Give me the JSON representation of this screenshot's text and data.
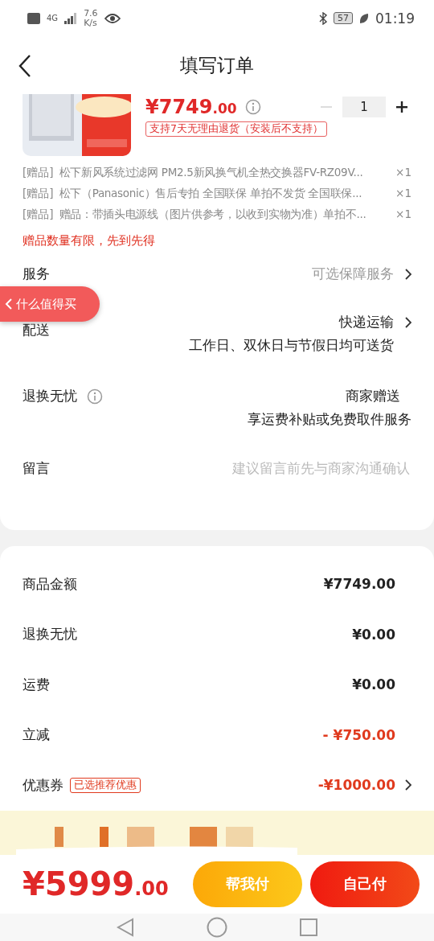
{
  "status_bar": {
    "network": "4G",
    "speed": "7.6",
    "speed_unit": "K/s",
    "battery": "57",
    "time": "01:19"
  },
  "header": {
    "title": "填写订单"
  },
  "product": {
    "kind": "picture",
    "price": {
      "currency": "¥",
      "integer": "7749",
      "decimals": ".00"
    },
    "quantity": "1",
    "minus_disabled": true,
    "return_tag": "支持7天无理由退货（安装后不支持）"
  },
  "gifts": [
    {
      "tag": "[赠品]",
      "name": "松下新风系统过滤网 PM2.5新风换气机全热交换器FV-RZ09V...",
      "count": "×1"
    },
    {
      "tag": "[赠品]",
      "name": "松下（Panasonic）售后专拍 全国联保 单拍不发货 全国联保...",
      "count": "×1"
    },
    {
      "tag": "[赠品]",
      "name": "赠品：带插头电源线（图片供参考，以收到实物为准）单拍不...",
      "count": "×1"
    }
  ],
  "gift_notice": "赠品数量有限，先到先得",
  "options": [
    {
      "label": "服务",
      "value": "可选保障服务",
      "muted": true,
      "chevron": true
    },
    {
      "label": "配送",
      "value": "快递运输",
      "detail": "工作日、双休日与节假日均可送货",
      "muted": false,
      "chevron": true
    },
    {
      "label": "退换无忧",
      "info": true,
      "value": "商家赠送",
      "detail": "享运费补贴或免费取件服务",
      "muted": false,
      "chevron": false
    },
    {
      "label": "留言",
      "placeholder": "建议留言前先与商家沟通确认"
    }
  ],
  "floating_pill": {
    "label": "什么值得买"
  },
  "summary": [
    {
      "label": "商品金额",
      "value": "¥7749.00",
      "highlight": false,
      "chevron": false
    },
    {
      "label": "退换无忧",
      "value": "¥0.00",
      "highlight": false,
      "chevron": false
    },
    {
      "label": "运费",
      "value": "¥0.00",
      "highlight": false,
      "chevron": false
    },
    {
      "label": "立减",
      "value": "- ¥750.00",
      "highlight": true,
      "chevron": false
    },
    {
      "label": "优惠券",
      "badge": "已选推荐优惠",
      "value": "-¥1000.00",
      "highlight": true,
      "chevron": true
    }
  ],
  "footer": {
    "total": {
      "currency": "¥",
      "integer": "5999",
      "decimals": ".00"
    },
    "buttons": [
      {
        "label": "帮我付",
        "kind": "secondary"
      },
      {
        "label": "自己付",
        "kind": "primary"
      }
    ]
  }
}
